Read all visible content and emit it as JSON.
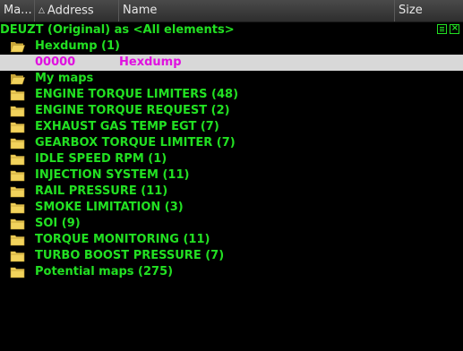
{
  "columns": {
    "ma": "Ma...",
    "address": "Address",
    "name": "Name",
    "size": "Size"
  },
  "tree": {
    "root_label": "DEUZT (Original) as <All elements>",
    "hexdump_group": "Hexdump (1)",
    "selected_row": {
      "address": "00000",
      "name": "Hexdump"
    },
    "folders": [
      "My maps",
      "ENGINE TORQUE LIMITERS (48)",
      "ENGINE TORQUE REQUEST (2)",
      "EXHAUST GAS TEMP EGT (7)",
      "GEARBOX TORQUE LIMITER (7)",
      "IDLE SPEED RPM (1)",
      "INJECTION SYSTEM (11)",
      "RAIL PRESSURE (11)",
      "SMOKE LIMITATION (3)",
      "SOI (9)",
      "TORQUE MONITORING (11)",
      "TURBO BOOST PRESSURE (7)",
      "Potential maps (275)"
    ]
  },
  "colors": {
    "text_green": "#22e022",
    "selected_text": "#e010e0",
    "selected_bg": "#d8d8d8",
    "folder_yellow": "#f2d35c"
  }
}
